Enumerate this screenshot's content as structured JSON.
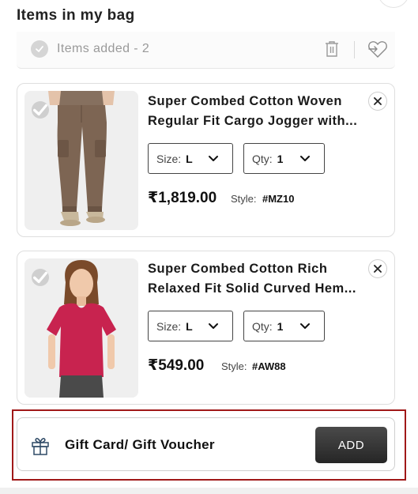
{
  "header": {
    "title": "Items in my bag"
  },
  "selection_bar": {
    "items_added_text": "Items added - 2",
    "icons": [
      "check-icon",
      "trash-icon",
      "move-to-wishlist-icon"
    ]
  },
  "products": [
    {
      "name_line1": "Super Combed Cotton Woven",
      "name_line2": "Regular Fit Cargo Jogger with...",
      "size_label": "Size:",
      "size_value": "L",
      "qty_label": "Qty:",
      "qty_value": "1",
      "price": "₹1,819.00",
      "style_label": "Style:",
      "style_value": "#MZ10"
    },
    {
      "name_line1": "Super Combed Cotton Rich",
      "name_line2": "Relaxed Fit Solid Curved Hem...",
      "size_label": "Size:",
      "size_value": "L",
      "qty_label": "Qty:",
      "qty_value": "1",
      "price": "₹549.00",
      "style_label": "Style:",
      "style_value": "#AW88"
    }
  ],
  "gift_card": {
    "label": "Gift Card/ Gift Voucher",
    "add_label": "ADD"
  },
  "colors": {
    "highlight_border": "#a01818",
    "add_button": "#2e2e2e",
    "jogger": "#7d6553",
    "tshirt": "#c8234f"
  }
}
